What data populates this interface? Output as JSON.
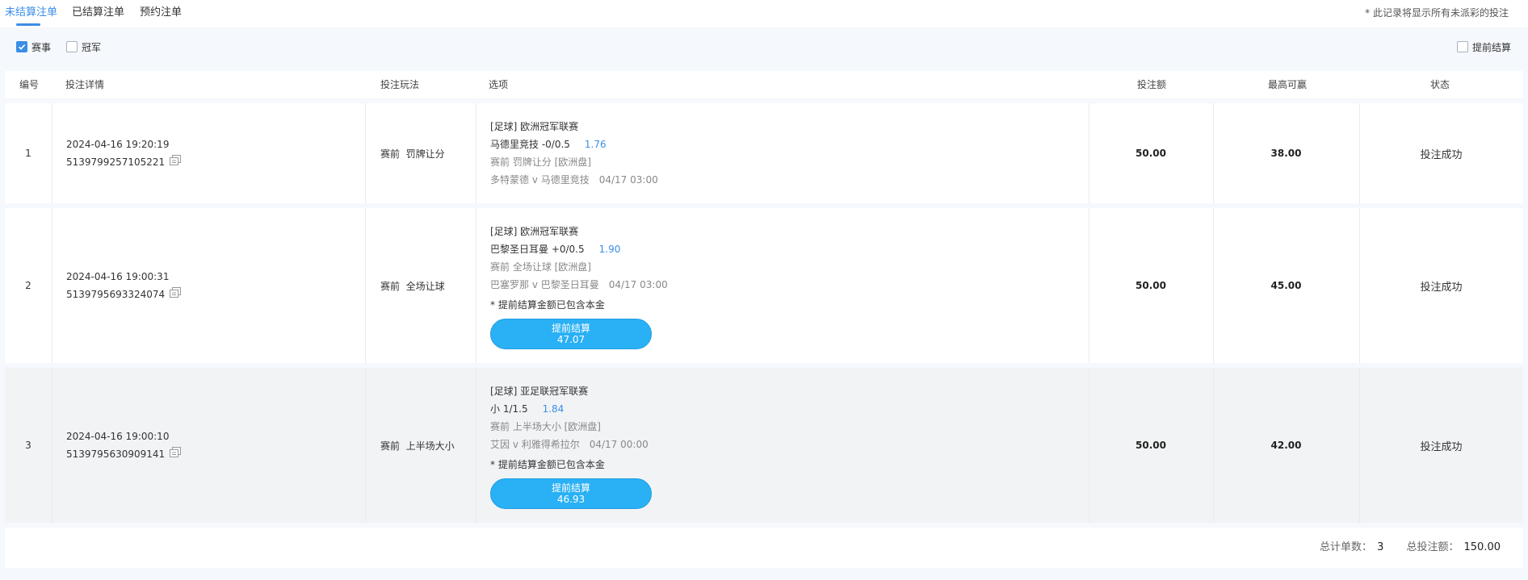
{
  "tabs": [
    {
      "label": "未结算注单",
      "active": true
    },
    {
      "label": "已结算注单",
      "active": false
    },
    {
      "label": "预约注单",
      "active": false
    }
  ],
  "notice": "* 此记录将显示所有未派彩的投注",
  "filters": {
    "match": {
      "label": "赛事",
      "checked": true
    },
    "champion": {
      "label": "冠军",
      "checked": false
    },
    "early_settle": {
      "label": "提前结算",
      "checked": false
    }
  },
  "columns": {
    "no": "编号",
    "detail": "投注详情",
    "play": "投注玩法",
    "option": "选项",
    "stake": "投注额",
    "max_win": "最高可赢",
    "status": "状态"
  },
  "rows": [
    {
      "no": "1",
      "time": "2024-04-16 19:20:19",
      "id": "5139799257105221",
      "play": "赛前  罚牌让分",
      "league": "[足球] 欧洲冠军联赛",
      "pick": "马德里竞技 -0/0.5",
      "odds": "1.76",
      "market": "赛前 罚牌让分 [欧洲盘]",
      "match": "多特蒙德 v 马德里竞技",
      "kickoff": "04/17 03:00",
      "stake": "50.00",
      "max_win": "38.00",
      "status": "投注成功"
    },
    {
      "no": "2",
      "time": "2024-04-16 19:00:31",
      "id": "5139795693324074",
      "play": "赛前  全场让球",
      "league": "[足球] 欧洲冠军联赛",
      "pick": "巴黎圣日耳曼 +0/0.5",
      "odds": "1.90",
      "market": "赛前 全场让球 [欧洲盘]",
      "match": "巴塞罗那 v 巴黎圣日耳曼",
      "kickoff": "04/17 03:00",
      "note": "* 提前结算金额已包含本金",
      "settle_label": "提前结算",
      "settle_value": "47.07",
      "stake": "50.00",
      "max_win": "45.00",
      "status": "投注成功"
    },
    {
      "no": "3",
      "time": "2024-04-16 19:00:10",
      "id": "5139795630909141",
      "play": "赛前  上半场大小",
      "league": "[足球] 亚足联冠军联赛",
      "pick": "小 1/1.5",
      "odds": "1.84",
      "market": "赛前 上半场大小 [欧洲盘]",
      "match": "艾因 v 利雅得希拉尔",
      "kickoff": "04/17 00:00",
      "note": "* 提前结算金额已包含本金",
      "settle_label": "提前结算",
      "settle_value": "46.93",
      "stake": "50.00",
      "max_win": "42.00",
      "status": "投注成功"
    }
  ],
  "summary": {
    "count_label": "总计单数：",
    "count": "3",
    "total_label": "总投注额：",
    "total": "150.00"
  },
  "colors": {
    "accent": "#3a8ee6",
    "button": "#29b0f5"
  }
}
